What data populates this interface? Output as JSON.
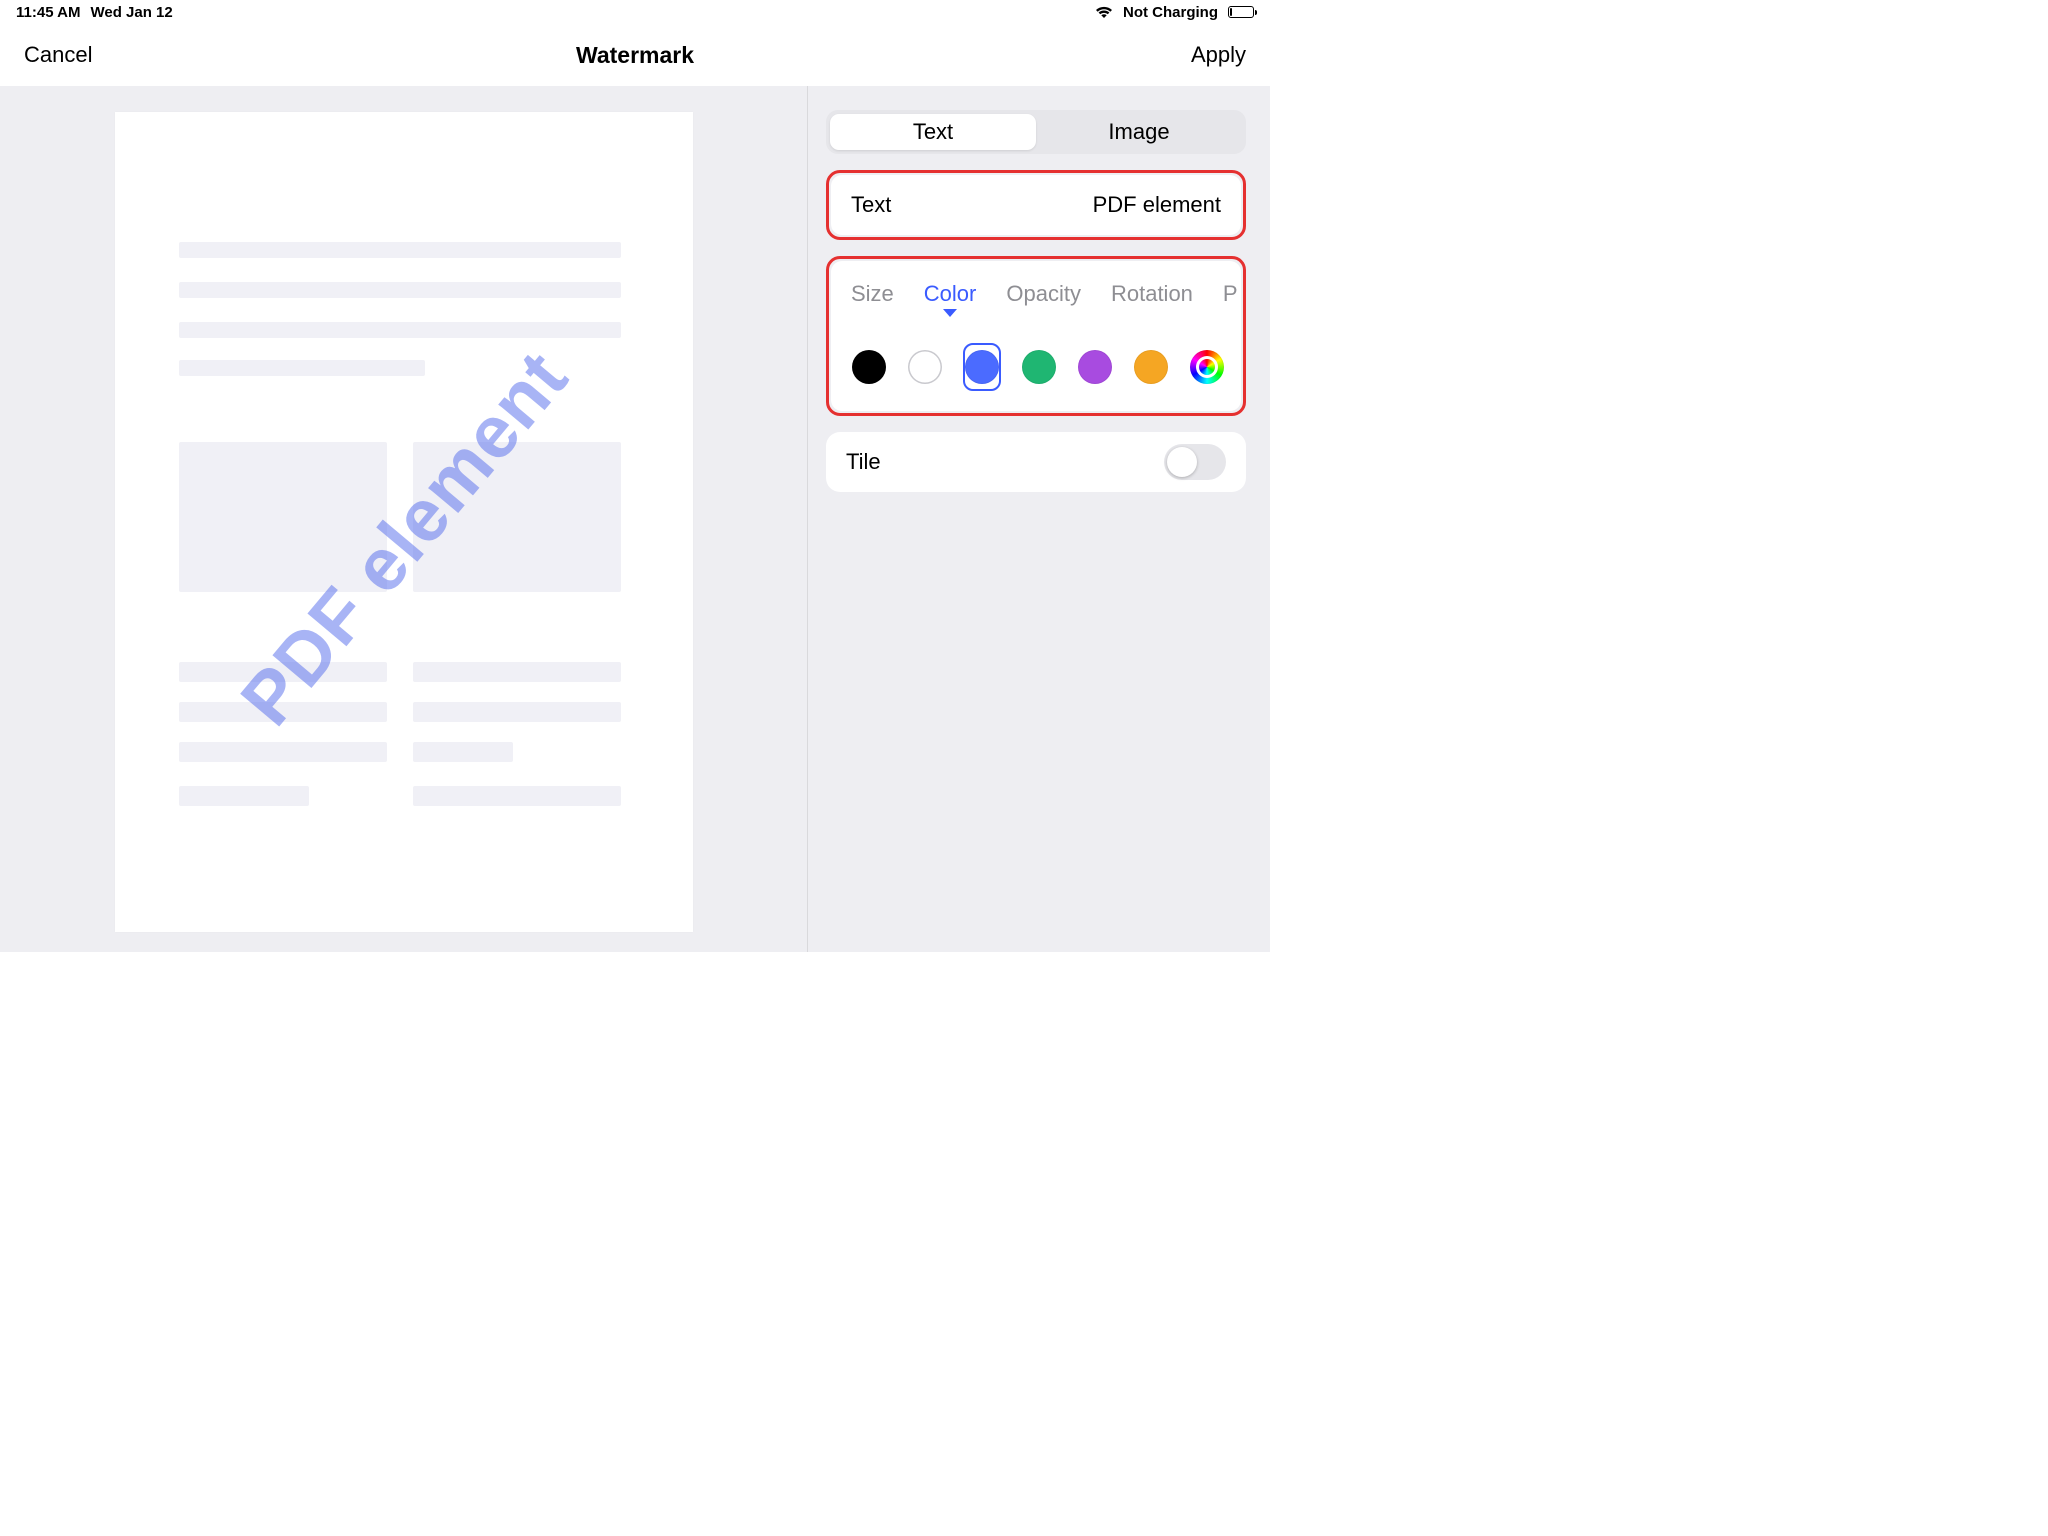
{
  "status": {
    "time": "11:45 AM",
    "date": "Wed Jan 12",
    "charging": "Not Charging"
  },
  "nav": {
    "cancel": "Cancel",
    "title": "Watermark",
    "apply": "Apply"
  },
  "preview": {
    "watermark_text": "PDF element"
  },
  "segmented": {
    "text": "Text",
    "image": "Image",
    "active": "text"
  },
  "text_row": {
    "label": "Text",
    "value": "PDF element"
  },
  "style_tabs": {
    "size": "Size",
    "color": "Color",
    "opacity": "Opacity",
    "rotation": "Rotation",
    "position_partial": "P",
    "active": "color"
  },
  "colors": {
    "black": "#000000",
    "white": "#ffffff",
    "blue": "#4b6bff",
    "green": "#1fb672",
    "purple": "#a84be0",
    "orange": "#f5a623",
    "selected": "blue"
  },
  "tile": {
    "label": "Tile",
    "on": false
  }
}
